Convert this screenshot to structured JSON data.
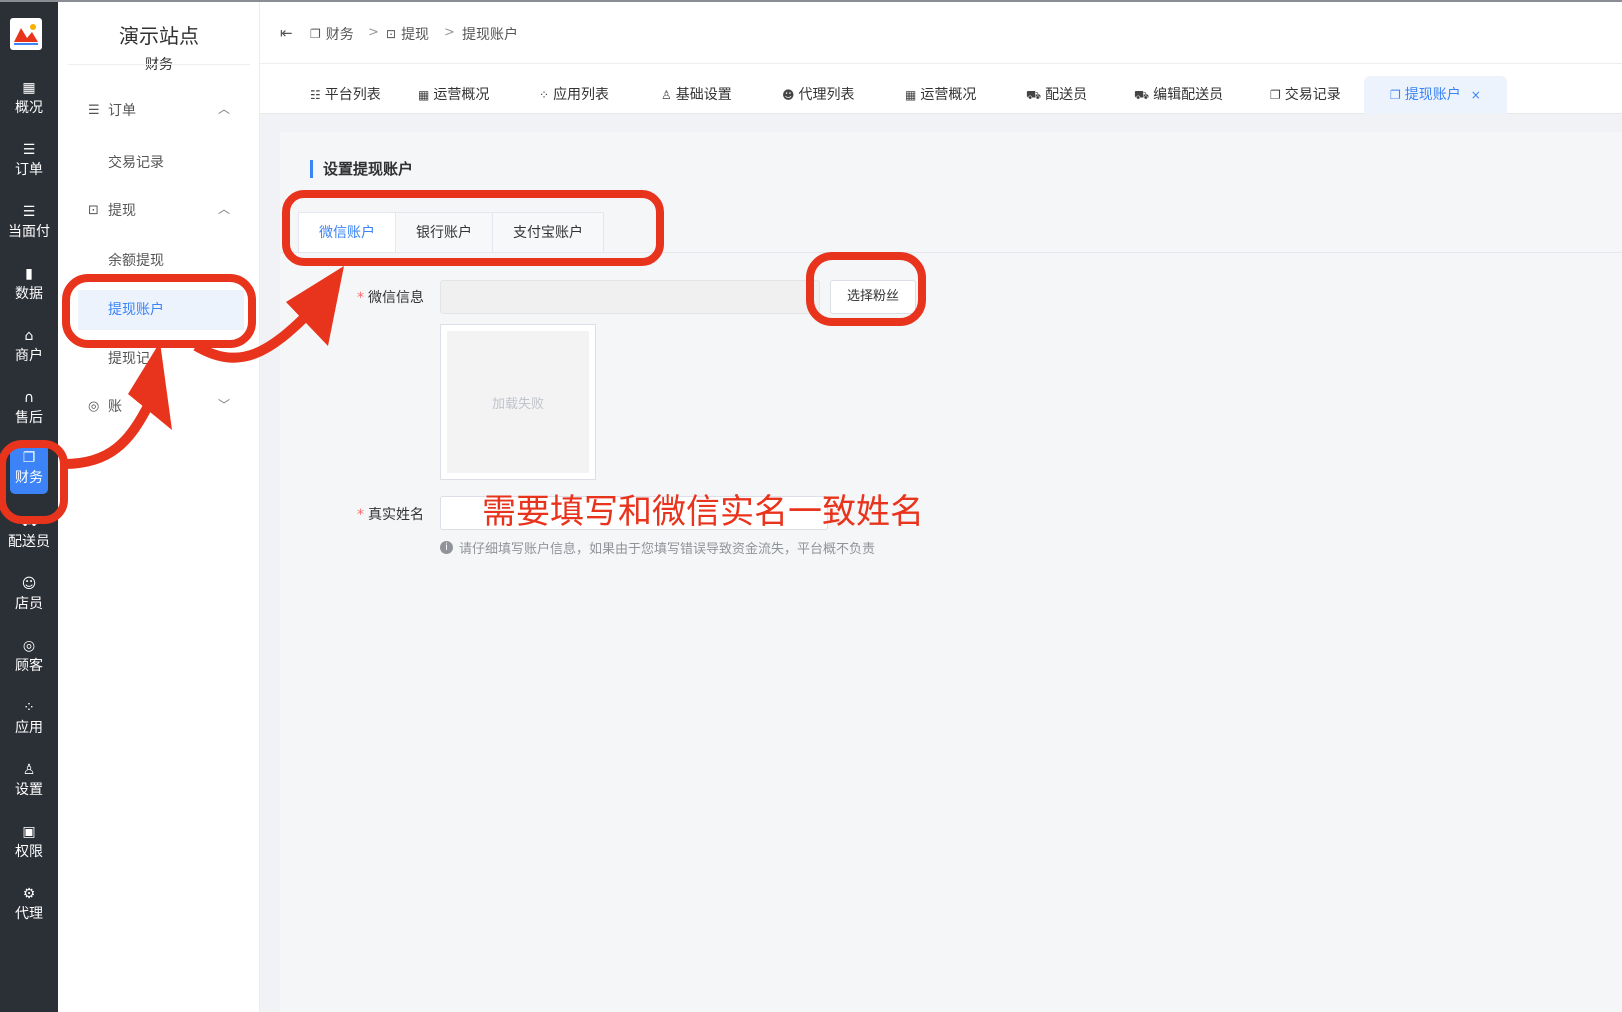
{
  "rail": {
    "items": [
      {
        "label": "概况",
        "icon": "dashboard-icon"
      },
      {
        "label": "订单",
        "icon": "list-icon"
      },
      {
        "label": "当面付",
        "icon": "list-icon"
      },
      {
        "label": "数据",
        "icon": "bar-chart-icon"
      },
      {
        "label": "商户",
        "icon": "shop-icon"
      },
      {
        "label": "售后",
        "icon": "headset-icon"
      },
      {
        "label": "财务",
        "icon": "copy-icon"
      },
      {
        "label": "配送员",
        "icon": "truck-icon"
      },
      {
        "label": "店员",
        "icon": "users-icon"
      },
      {
        "label": "顾客",
        "icon": "user-circle-icon"
      },
      {
        "label": "应用",
        "icon": "apps-icon"
      },
      {
        "label": "设置",
        "icon": "user-gear-icon"
      },
      {
        "label": "权限",
        "icon": "lock-icon"
      },
      {
        "label": "代理",
        "icon": "gear-icon"
      }
    ],
    "active": "财务"
  },
  "menu": {
    "site_title": "演示站点",
    "site_sub": "财务",
    "group_orders": "订单",
    "item_trade_record": "交易记录",
    "group_withdraw": "提现",
    "item_balance_withdraw": "余额提现",
    "item_withdraw_account": "提现账户",
    "item_withdraw_record": "提现记",
    "group_account": "账"
  },
  "breadcrumb": {
    "items": [
      "财务",
      "提现",
      "提现账户"
    ],
    "separator": ">"
  },
  "tabs": [
    {
      "label": "平台列表"
    },
    {
      "label": "运营概况"
    },
    {
      "label": "应用列表"
    },
    {
      "label": "基础设置"
    },
    {
      "label": "代理列表"
    },
    {
      "label": "运营概况"
    },
    {
      "label": "配送员"
    },
    {
      "label": "编辑配送员"
    },
    {
      "label": "交易记录"
    },
    {
      "label": "提现账户",
      "close": "×"
    }
  ],
  "page": {
    "section_title": "设置提现账户",
    "account_tabs": [
      "微信账户",
      "银行账户",
      "支付宝账户"
    ],
    "wechat_label": "微信信息",
    "select_fans_button": "选择粉丝",
    "image_fail_text": "加载失败",
    "realname_label": "真实姓名",
    "required_mark": "*",
    "hint": "请仔细填写账户信息，如果由于您填写错误导致资金流失，平台概不负责"
  },
  "annotation": {
    "text": "需要填写和微信实名一致姓名",
    "color": "#e8341c"
  },
  "colors": {
    "accent": "#3b83f6",
    "rail_bg": "#2b2f36",
    "annotation": "#e8341c"
  }
}
